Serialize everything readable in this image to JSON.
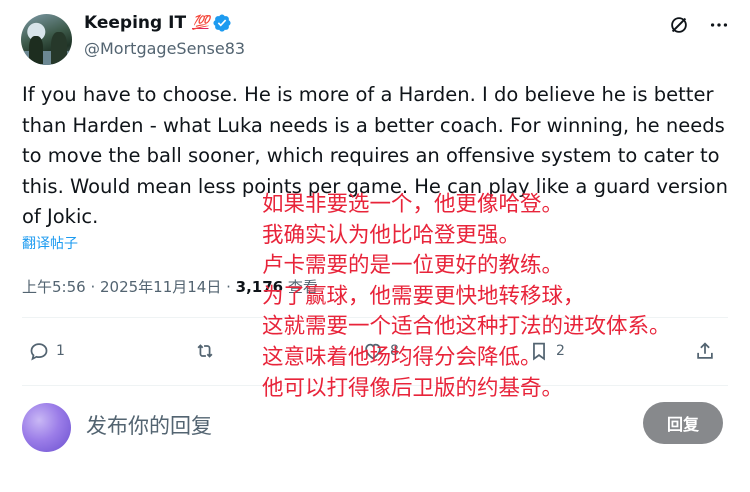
{
  "author": {
    "display_name": "Keeping IT",
    "badge": "💯",
    "handle": "@MortgageSense83",
    "verified": true
  },
  "top_actions": [
    "grok-icon",
    "more-icon"
  ],
  "tweet": {
    "text": "If you have to choose. He is more of a Harden. I do believe he is better than Harden - what Luka needs is a better coach. For winning, he needs to move the ball sooner, which requires an offensive system to cater to this. Would mean less points per game. He can play like a guard version of Jokic.",
    "translate_label": "翻译帖子",
    "timestamp": "上午5:56 · 2025年11月14日 · ",
    "views_count": "3,176",
    "views_label": " 查看"
  },
  "actions": {
    "replies": "1",
    "retweets": "",
    "likes": "8",
    "bookmarks": "2"
  },
  "reply_box": {
    "placeholder": "发布你的回复",
    "button_label": "回复"
  },
  "overlay_translation": {
    "line1": "如果非要选一个，他更像哈登。",
    "line2": "我确实认为他比哈登更强。",
    "line3": "卢卡需要的是一位更好的教练。",
    "line4": "为了赢球，他需要更快地转移球，",
    "line5": "这就需要一个适合他这种打法的进攻体系。",
    "line6": "这意味着他场均得分会降低。",
    "line7": "他可以打得像后卫版的约基奇。"
  },
  "colors": {
    "accent": "#1d9bf0",
    "overlay_text": "#e8243a",
    "secondary_text": "#536471",
    "reply_button": "#87898c"
  }
}
